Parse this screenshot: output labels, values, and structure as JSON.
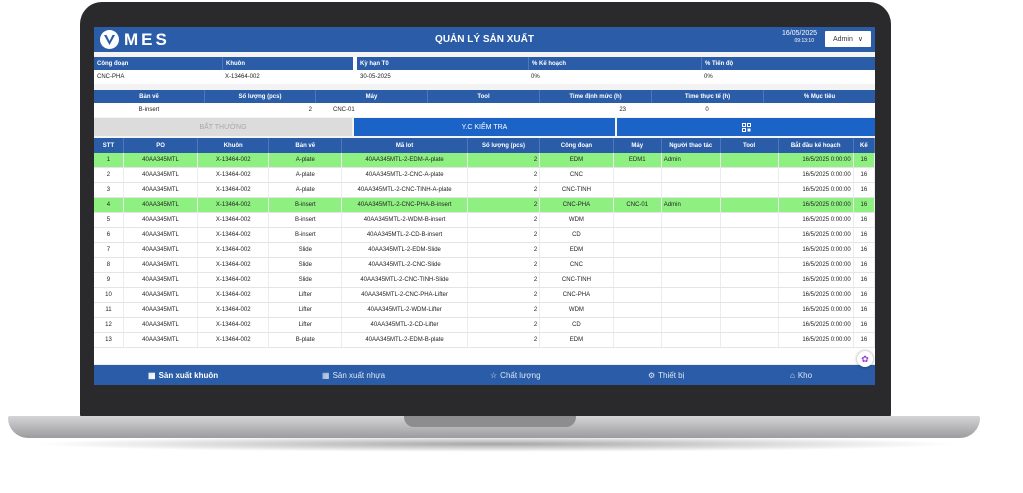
{
  "header": {
    "logo_text": "MES",
    "title": "QUẢN LÝ SẢN XUẤT",
    "date": "16/05/2025",
    "time": "09:13:10",
    "user_dropdown": "Admin"
  },
  "info_row1": {
    "labels": [
      "Công đoạn",
      "Khuôn",
      "Kỳ hạn T0",
      "% Kế hoạch",
      "% Tiến độ"
    ],
    "values": [
      "CNC-PHA",
      "X-13464-002",
      "30-05-2025",
      "0%",
      "0%"
    ]
  },
  "info_row2": {
    "labels": [
      "Bản vẽ",
      "Số lượng (pcs)",
      "Máy",
      "Tool",
      "Time định mức (h)",
      "Time thực tế (h)",
      "% Mục tiêu"
    ],
    "values": [
      "B-insert",
      "2",
      "CNC-01",
      "",
      "23",
      "0",
      ""
    ]
  },
  "actions": {
    "abnormal": "BẤT THƯỜNG",
    "inspect_request": "Y.C KIỂM TRA"
  },
  "table": {
    "headers": [
      "STT",
      "PO",
      "Khuôn",
      "Bản vẽ",
      "Mã lot",
      "Số lượng (pcs)",
      "Công đoạn",
      "Máy",
      "Người thao tác",
      "Tool",
      "Bắt đầu kế hoạch",
      "Kế"
    ],
    "rows": [
      [
        "1",
        "40AA345MTL",
        "X-13464-002",
        "A-plate",
        "40AA345MTL-2-EDM-A-plate",
        "2",
        "EDM",
        "EDM1",
        "Admin",
        "",
        "16/5/2025 0:00:00",
        "16"
      ],
      [
        "2",
        "40AA345MTL",
        "X-13464-002",
        "A-plate",
        "40AA345MTL-2-CNC-A-plate",
        "2",
        "CNC",
        "",
        "",
        "",
        "16/5/2025 0:00:00",
        "16"
      ],
      [
        "3",
        "40AA345MTL",
        "X-13464-002",
        "A-plate",
        "40AA345MTL-2-CNC-TINH-A-plate",
        "2",
        "CNC-TINH",
        "",
        "",
        "",
        "16/5/2025 0:00:00",
        "16"
      ],
      [
        "4",
        "40AA345MTL",
        "X-13464-002",
        "B-insert",
        "40AA345MTL-2-CNC-PHA-B-insert",
        "2",
        "CNC-PHA",
        "CNC-01",
        "Admin",
        "",
        "16/5/2025 0:00:00",
        "16"
      ],
      [
        "5",
        "40AA345MTL",
        "X-13464-002",
        "B-insert",
        "40AA345MTL-2-WDM-B-insert",
        "2",
        "WDM",
        "",
        "",
        "",
        "16/5/2025 0:00:00",
        "16"
      ],
      [
        "6",
        "40AA345MTL",
        "X-13464-002",
        "B-insert",
        "40AA345MTL-2-CD-B-insert",
        "2",
        "CD",
        "",
        "",
        "",
        "16/5/2025 0:00:00",
        "16"
      ],
      [
        "7",
        "40AA345MTL",
        "X-13464-002",
        "Slide",
        "40AA345MTL-2-EDM-Slide",
        "2",
        "EDM",
        "",
        "",
        "",
        "16/5/2025 0:00:00",
        "16"
      ],
      [
        "8",
        "40AA345MTL",
        "X-13464-002",
        "Slide",
        "40AA345MTL-2-CNC-Slide",
        "2",
        "CNC",
        "",
        "",
        "",
        "16/5/2025 0:00:00",
        "16"
      ],
      [
        "9",
        "40AA345MTL",
        "X-13464-002",
        "Slide",
        "40AA345MTL-2-CNC-TINH-Slide",
        "2",
        "CNC-TINH",
        "",
        "",
        "",
        "16/5/2025 0:00:00",
        "16"
      ],
      [
        "10",
        "40AA345MTL",
        "X-13464-002",
        "Lifter",
        "40AA345MTL-2-CNC-PHA-Lifter",
        "2",
        "CNC-PHA",
        "",
        "",
        "",
        "16/5/2025 0:00:00",
        "16"
      ],
      [
        "11",
        "40AA345MTL",
        "X-13464-002",
        "Lifter",
        "40AA345MTL-2-WDM-Lifter",
        "2",
        "WDM",
        "",
        "",
        "",
        "16/5/2025 0:00:00",
        "16"
      ],
      [
        "12",
        "40AA345MTL",
        "X-13464-002",
        "Lifter",
        "40AA345MTL-2-CD-Lifter",
        "2",
        "CD",
        "",
        "",
        "",
        "16/5/2025 0:00:00",
        "16"
      ],
      [
        "13",
        "40AA345MTL",
        "X-13464-002",
        "B-plate",
        "40AA345MTL-2-EDM-B-plate",
        "2",
        "EDM",
        "",
        "",
        "",
        "16/5/2025 0:00:00",
        "16"
      ]
    ],
    "highlighted_rows": [
      0,
      3
    ]
  },
  "bottom_nav": [
    {
      "label": "Sản xuất khuôn",
      "icon": "grid-icon",
      "active": true
    },
    {
      "label": "Sản xuất nhựa",
      "icon": "grid-icon",
      "active": false
    },
    {
      "label": "Chất lượng",
      "icon": "star-icon",
      "active": false
    },
    {
      "label": "Thiết bị",
      "icon": "gear-icon",
      "active": false
    },
    {
      "label": "Kho",
      "icon": "home-icon",
      "active": false
    }
  ],
  "colors": {
    "primary": "#2a5ca8",
    "highlight_row": "#8ef080",
    "action_accent": "#1b63c6"
  }
}
